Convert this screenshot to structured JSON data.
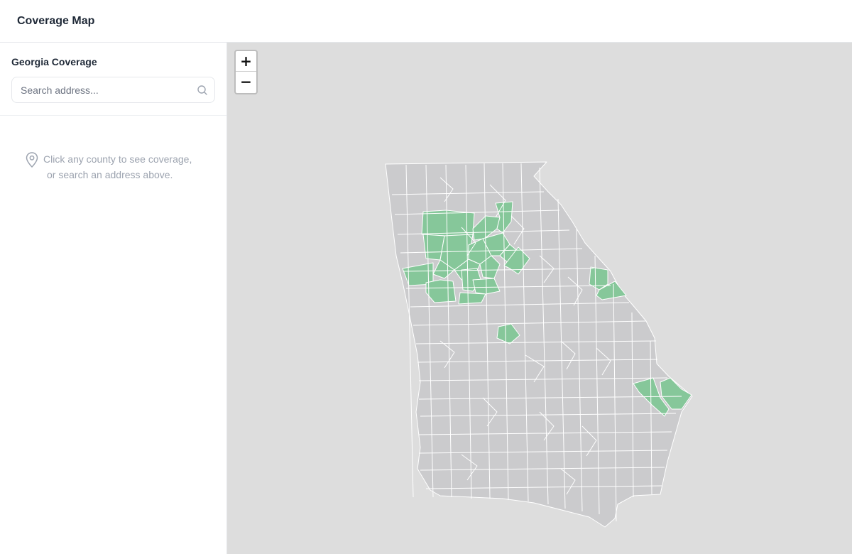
{
  "header": {
    "title": "Coverage Map"
  },
  "sidebar": {
    "title": "Georgia Coverage",
    "search": {
      "placeholder": "Search address...",
      "value": "",
      "icon": "search-icon"
    },
    "hint": {
      "icon": "map-pin-icon",
      "line1": "Click any county to see coverage,",
      "line2": "or search an address above."
    }
  },
  "map": {
    "region": "Georgia",
    "zoom_in_label": "+",
    "zoom_out_label": "−",
    "colors": {
      "background": "#dddddd",
      "county_default": "#cbcbcd",
      "county_covered": "#86c79a",
      "county_border": "#ffffff"
    },
    "legend_note": "",
    "covered_regions": [
      "north-metro",
      "ne-corridor",
      "augusta",
      "macon",
      "coastal-se"
    ]
  }
}
